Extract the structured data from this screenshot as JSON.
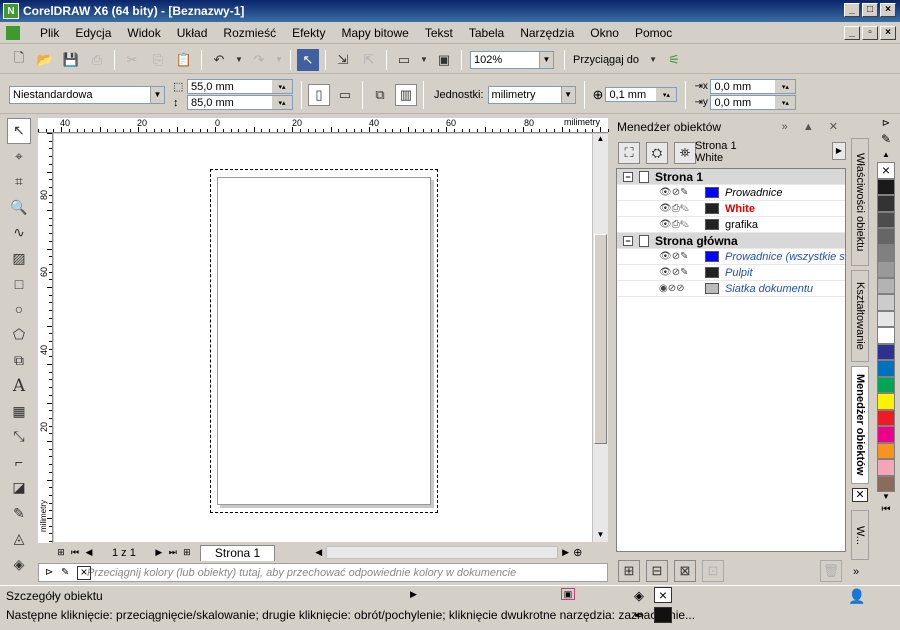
{
  "window": {
    "title": "CorelDRAW X6 (64 bity) - [Beznazwy-1]"
  },
  "menu": [
    "Plik",
    "Edycja",
    "Widok",
    "Układ",
    "Rozmieść",
    "Efekty",
    "Mapy bitowe",
    "Tekst",
    "Tabela",
    "Narzędzia",
    "Okno",
    "Pomoc"
  ],
  "toolbar": {
    "zoom": "102%",
    "snap_label": "Przyciągaj do"
  },
  "propbar": {
    "paper_preset": "Niestandardowa",
    "width": "55,0 mm",
    "height": "85,0 mm",
    "units_label": "Jednostki:",
    "units_value": "milimetry",
    "nudge": "0,1 mm",
    "dup_x": "0,0 mm",
    "dup_y": "0,0 mm"
  },
  "ruler": {
    "top_labels": [
      "40",
      "20",
      "0",
      "20",
      "40",
      "60",
      "80"
    ],
    "top_unit": "milimetry",
    "left_labels": [
      "80",
      "60",
      "40",
      "20"
    ],
    "left_unit": "milimetry"
  },
  "pagebar": {
    "page_count": "1 z 1",
    "tab": "Strona 1"
  },
  "color_hint": "Przeciągnij kolory (lub obiekty) tutaj, aby przechować odpowiednie kolory w dokumencie",
  "object_manager": {
    "title": "Menedżer obiektów",
    "current_page": "Strona 1",
    "current_layer": "White",
    "pages": [
      {
        "name": "Strona 1",
        "layers": [
          {
            "name": "Prowadnice",
            "color": "#0000ff",
            "style": "italic"
          },
          {
            "name": "White",
            "color": "#222222",
            "style": "active"
          },
          {
            "name": "grafika",
            "color": "#222222",
            "style": "normal"
          }
        ]
      },
      {
        "name": "Strona główna",
        "layers": [
          {
            "name": "Prowadnice (wszystkie s",
            "color": "#0000ff",
            "style": "master"
          },
          {
            "name": "Pulpit",
            "color": "#222222",
            "style": "master"
          },
          {
            "name": "Siatka dokumentu",
            "color": "#bbbbbb",
            "style": "master"
          }
        ]
      }
    ]
  },
  "side_tabs": [
    "Właściwości obiektu",
    "Kształtowanie",
    "Menedżer obiektów",
    "W..."
  ],
  "palette": [
    "#1a1a1a",
    "#333333",
    "#4d4d4d",
    "#666666",
    "#808080",
    "#999999",
    "#b3b3b3",
    "#cccccc",
    "#e6e6e6",
    "#ffffff",
    "#2e3192",
    "#0072bc",
    "#00a651",
    "#fff200",
    "#ed1c24",
    "#ec008c",
    "#f7941d",
    "#f5a5b8",
    "#8b6c5c"
  ],
  "status": {
    "details": "Szczegóły obiektu",
    "hint": "Następne kliknięcie: przeciągnięcie/skalowanie; drugie kliknięcie: obrót/pochylenie; kliknięcie dwukrotne narzędzia: zaznaczenie..."
  }
}
